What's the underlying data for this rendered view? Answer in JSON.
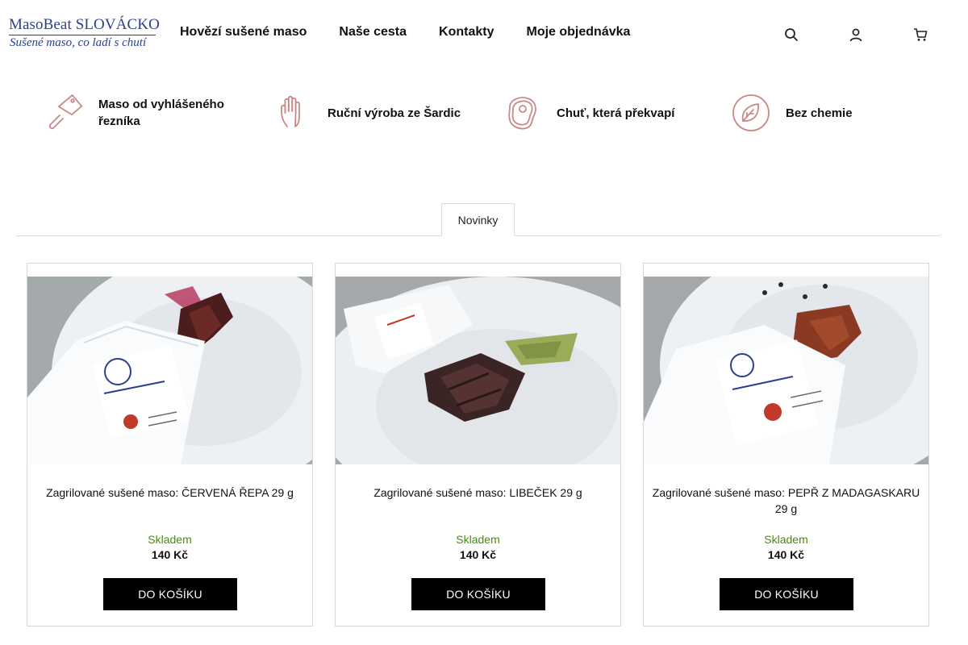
{
  "logo": {
    "title": "MasoBeat SLOVÁCKO",
    "subtitle": "Sušené maso, co ladí s chutí"
  },
  "nav": [
    "Hovězí sušené maso",
    "Naše cesta",
    "Kontakty",
    "Moje objednávka"
  ],
  "header_icons": [
    "search-icon",
    "user-icon",
    "cart-icon"
  ],
  "features": [
    {
      "icon": "cleaver-icon",
      "text": "Maso od vyhlášeného řezníka"
    },
    {
      "icon": "hand-icon",
      "text": "Ruční výroba ze Šardic"
    },
    {
      "icon": "steak-icon",
      "text": "Chuť, která překvapí"
    },
    {
      "icon": "leaf-icon",
      "text": "Bez chemie"
    }
  ],
  "tabs": {
    "active": "Novinky"
  },
  "products": [
    {
      "name": "Zagrilované sušené maso: ČERVENÁ ŘEPA 29 g",
      "stock": "Skladem",
      "price": "140 Kč",
      "button": "DO KOŠÍKU",
      "image": "jerky-beetroot-photo"
    },
    {
      "name": "Zagrilované sušené maso: LIBEČEK 29 g",
      "stock": "Skladem",
      "price": "140 Kč",
      "button": "DO KOŠÍKU",
      "image": "jerky-lovage-photo"
    },
    {
      "name": "Zagrilované sušené maso: PEPŘ Z MADAGASKARU 29 g",
      "stock": "Skladem",
      "price": "140 Kč",
      "button": "DO KOŠÍKU",
      "image": "jerky-pepper-photo"
    }
  ],
  "colors": {
    "brand": "#2b3f8c",
    "accent_icon": "#c98a86",
    "stock": "#4b8a12",
    "button": "#000000"
  }
}
